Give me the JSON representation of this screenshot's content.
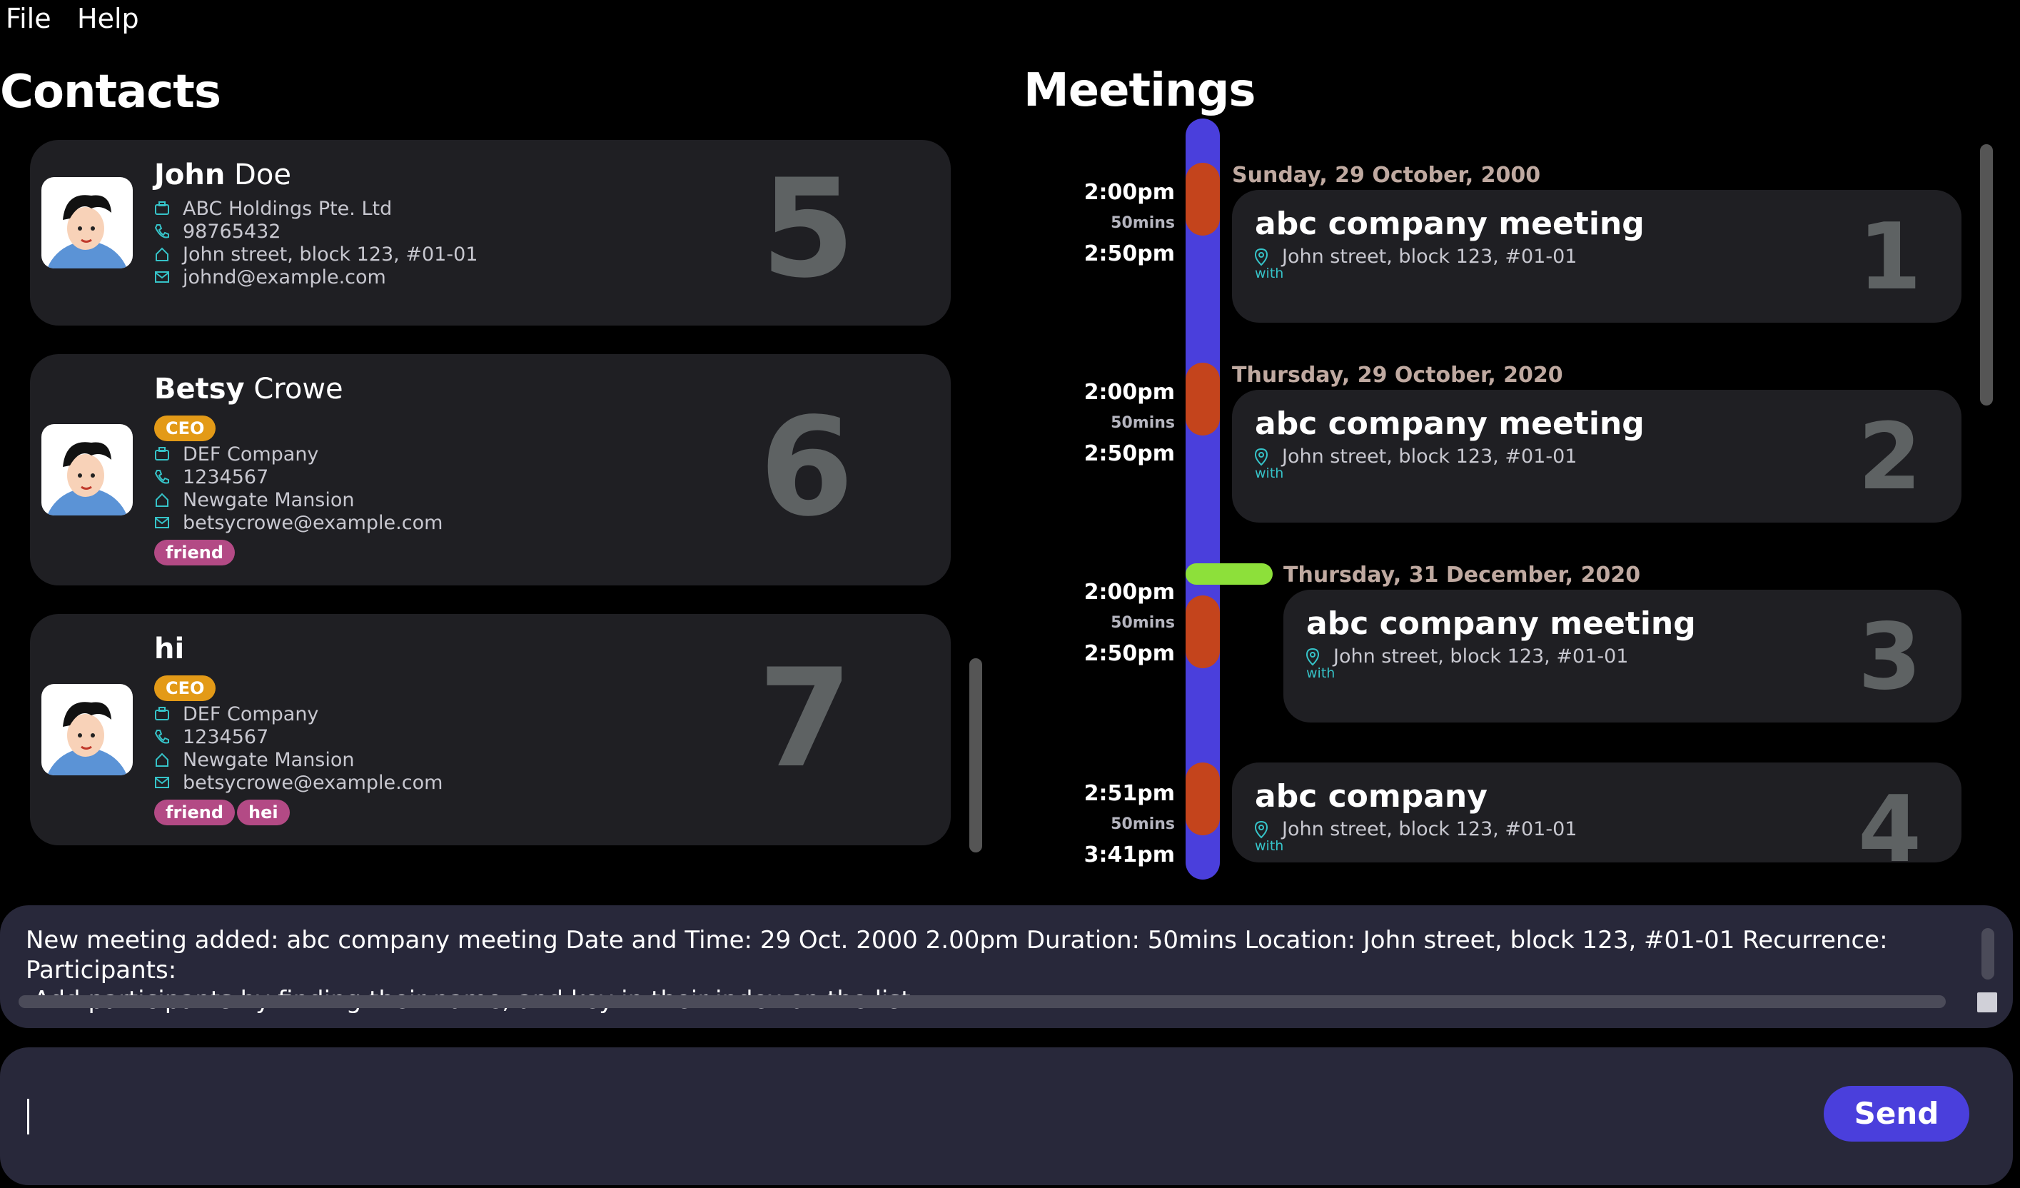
{
  "menu": {
    "file": "File",
    "help": "Help"
  },
  "contacts": {
    "title": "Contacts",
    "items": [
      {
        "first": "John",
        "last": "Doe",
        "roles": [],
        "company": "ABC Holdings Pte. Ltd",
        "phone": "98765432",
        "address": "John street, block 123, #01-01",
        "email": "johnd@example.com",
        "tags": [],
        "index": "5"
      },
      {
        "first": "Betsy",
        "last": "Crowe",
        "roles": [
          "CEO"
        ],
        "company": "DEF Company",
        "phone": "1234567",
        "address": "Newgate Mansion",
        "email": "betsycrowe@example.com",
        "tags": [
          "friend"
        ],
        "index": "6"
      },
      {
        "first": "hi",
        "last": "",
        "roles": [
          "CEO"
        ],
        "company": "DEF Company",
        "phone": "1234567",
        "address": "Newgate Mansion",
        "email": "betsycrowe@example.com",
        "tags": [
          "friend",
          "hei"
        ],
        "index": "7"
      }
    ]
  },
  "meetings": {
    "title": "Meetings",
    "items": [
      {
        "date": "Sunday, 29 October, 2000",
        "start": "2:00pm",
        "duration": "50mins",
        "end": "2:50pm",
        "title": "abc company meeting",
        "location": "John street, block 123, #01-01",
        "with": "with",
        "index": "1"
      },
      {
        "date": "Thursday, 29 October, 2020",
        "start": "2:00pm",
        "duration": "50mins",
        "end": "2:50pm",
        "title": "abc company meeting",
        "location": "John street, block 123, #01-01",
        "with": "with",
        "index": "2"
      },
      {
        "date": "Thursday, 31 December, 2020",
        "start": "2:00pm",
        "duration": "50mins",
        "end": "2:50pm",
        "title": "abc company meeting",
        "location": "John street, block 123, #01-01",
        "with": "with",
        "index": "3"
      },
      {
        "date": "",
        "start": "2:51pm",
        "duration": "50mins",
        "end": "3:41pm",
        "title": "abc company",
        "location": "John street, block 123, #01-01",
        "with": "with",
        "index": "4"
      }
    ]
  },
  "result": {
    "line1": "New meeting added: abc company meeting Date and Time: 29 Oct. 2000 2.00pm Duration:  50mins Location: John street, block 123, #01-01 Recurrence:  Participants:",
    "line2": " Add participants by finding their name, and key in their index on the list"
  },
  "command": {
    "value": "",
    "send_label": "Send"
  },
  "colors": {
    "accent": "#4a3fdc",
    "meeting_block": "#c4441c",
    "now_marker": "#8de03a",
    "ceo": "#e39a17",
    "tag": "#b34a85",
    "icon": "#36c3c8"
  }
}
